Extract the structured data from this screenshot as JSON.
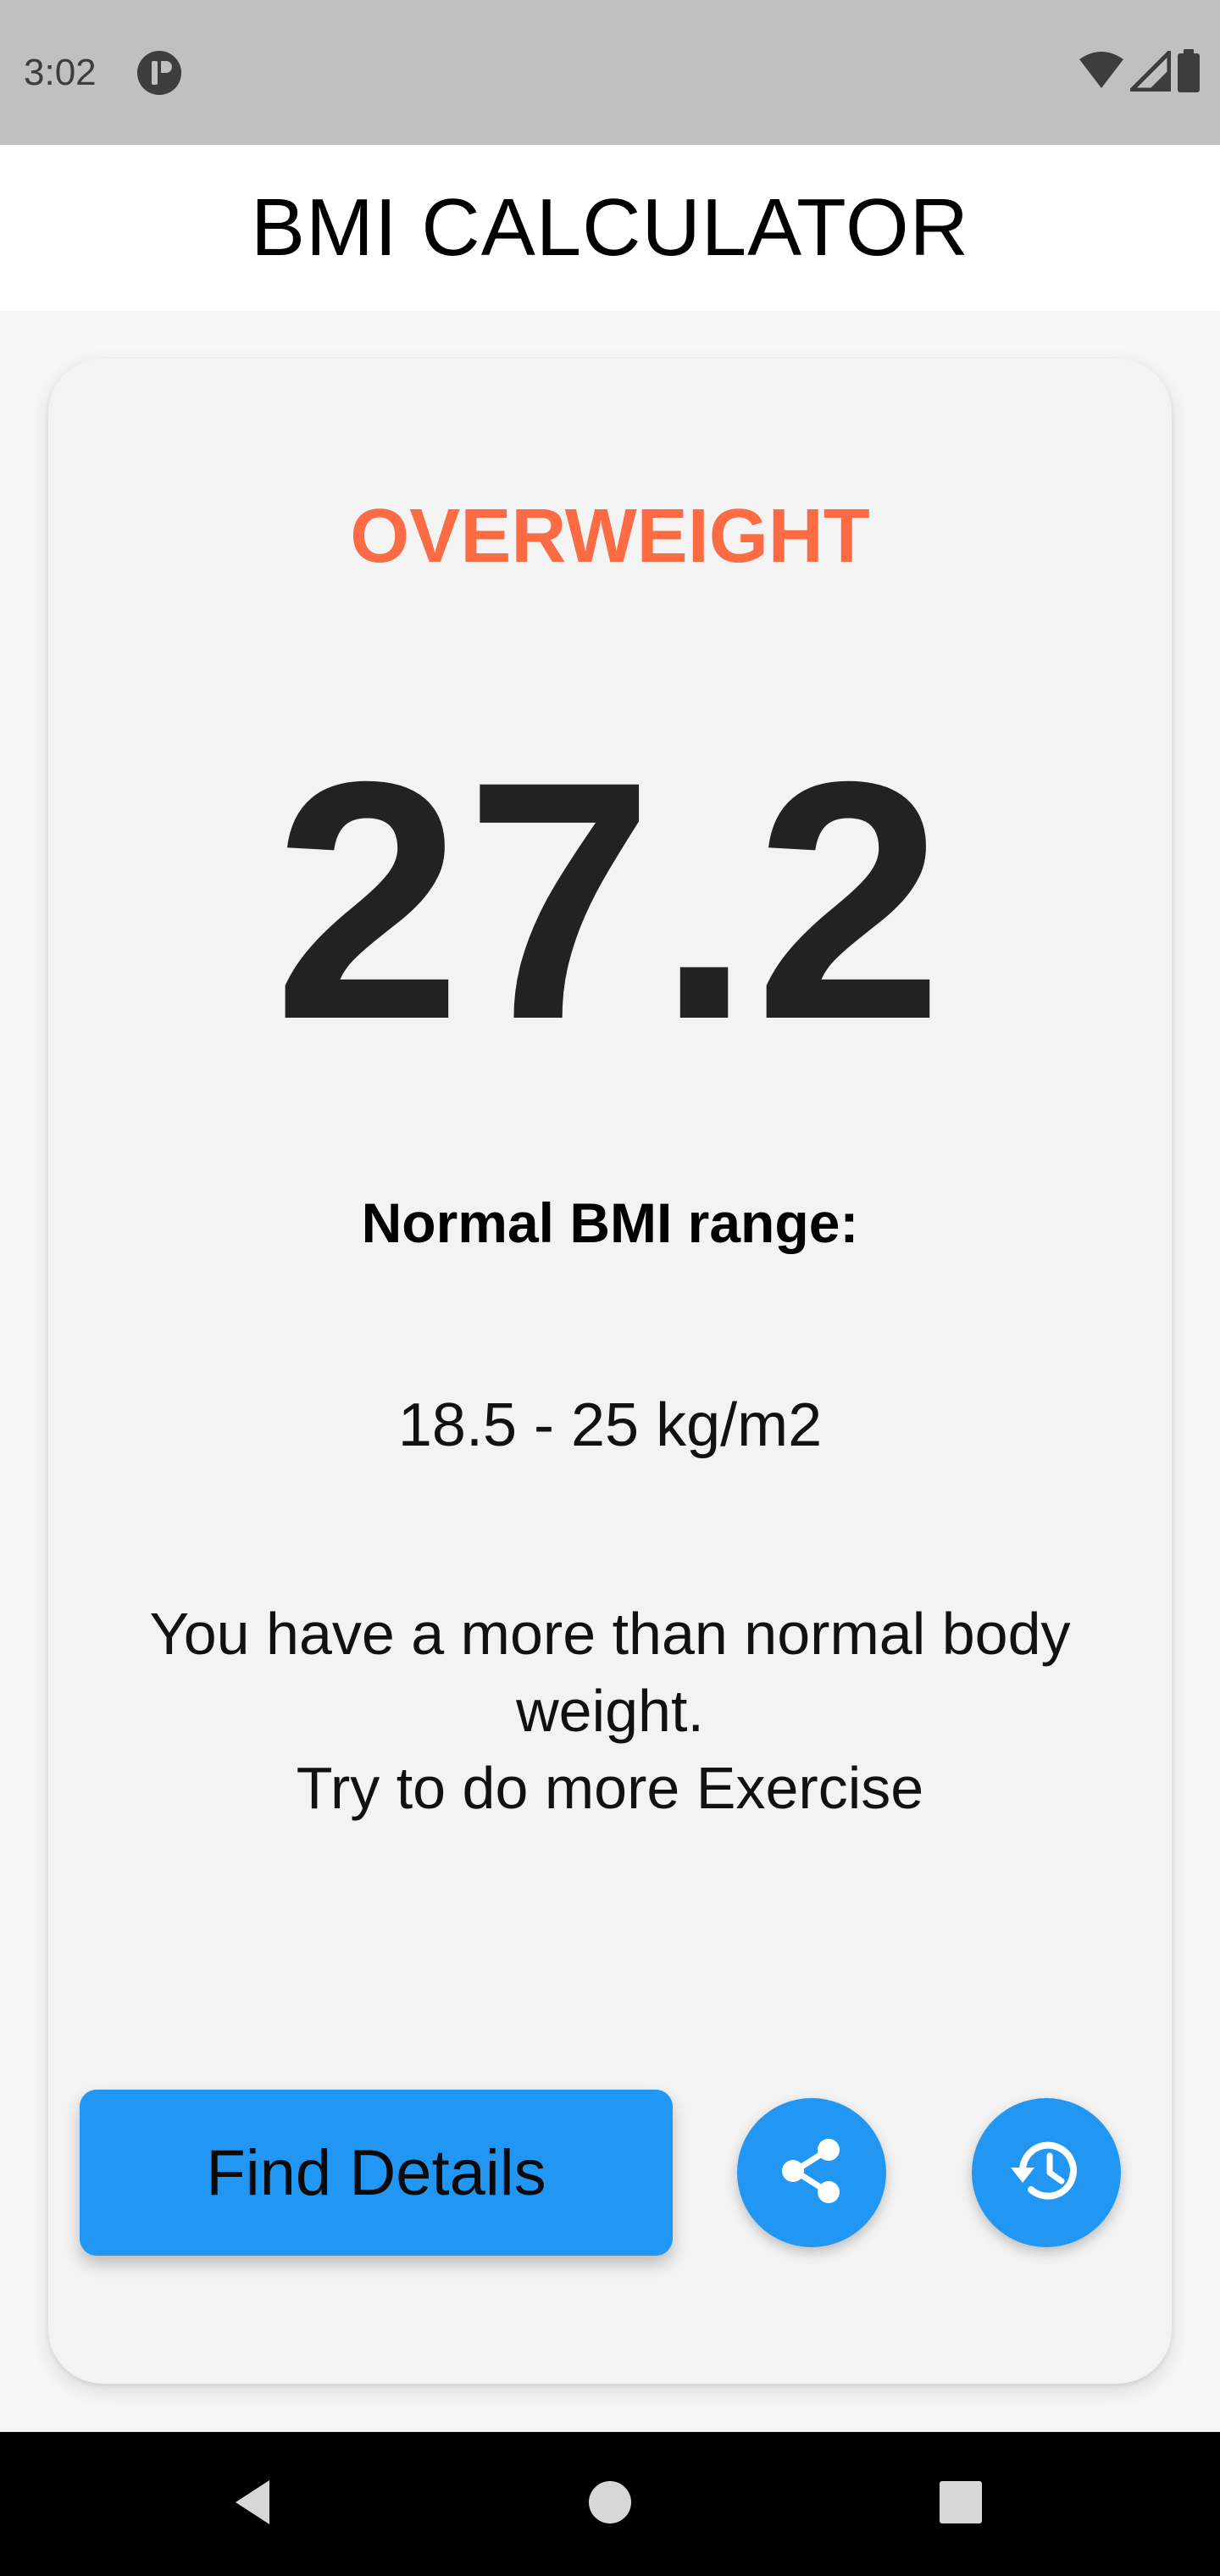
{
  "status_bar": {
    "time": "3:02",
    "icons": [
      "app-notification-icon",
      "wifi-icon",
      "cellular-signal-icon",
      "battery-icon"
    ]
  },
  "app_bar": {
    "title": "BMI CALCULATOR"
  },
  "result": {
    "category": "OVERWEIGHT",
    "bmi": "27.2",
    "normal_range_heading": "Normal BMI range:",
    "normal_range_value": "18.5 - 25 kg/m2",
    "advice_lines": [
      "You have a more than normal body",
      "weight.",
      "Try to do more Exercise"
    ]
  },
  "actions": {
    "find_details_label": "Find Details",
    "share_icon": "share-icon",
    "history_icon": "history-icon"
  },
  "nav_bar": {
    "icons": [
      "back-icon",
      "home-icon",
      "recents-icon"
    ]
  },
  "colors": {
    "accent": "#2196f3",
    "category": "#fb6c44",
    "status_bar": "#c0c0c0",
    "card": "#f3f3f3"
  }
}
